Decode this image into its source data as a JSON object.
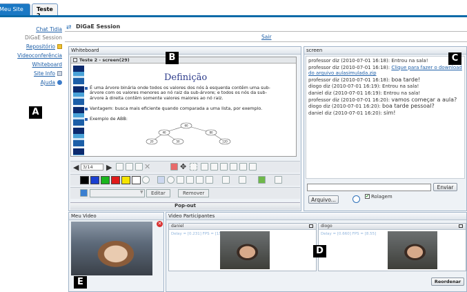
{
  "tabs": [
    {
      "label": "Meu Site"
    },
    {
      "label": "Teste 2"
    }
  ],
  "nav": {
    "items": [
      {
        "label": "Chat Tidia"
      },
      {
        "label": "DiGaE Session"
      },
      {
        "label": "Repositório"
      },
      {
        "label": "Videoconferência"
      },
      {
        "label": "Whiteboard"
      },
      {
        "label": "Site Info"
      },
      {
        "label": "Ajuda"
      }
    ]
  },
  "session": {
    "title": "DiGaE Session",
    "logout": "Sair"
  },
  "whiteboard": {
    "header": "Whiteboard",
    "slide_window_title": "Teste 2 - screen(29)",
    "slide_title": "Definição",
    "bullets": [
      "É uma árvore binária onde todos os valores dos nós à esquerda contêm uma sub-árvore com os valores menores ao nó raiz da sub-árvore; e todos os nós da sub-árvore à direita contêm somente valores maiores ao nó raiz.",
      "Vantagem: busca mais eficiente quando comparada a uma lista, por exemplo.",
      "Exemplo de ABB:"
    ],
    "tree_nodes": [
      "60",
      "40",
      "80",
      "20",
      "50",
      "120"
    ],
    "page_indicator": "3/14",
    "edit_button": "Editar",
    "remove_button": "Remover",
    "popout": "Pop-out",
    "palette": [
      "#000000",
      "#1a3fd1",
      "#19b51e",
      "#e01a1a",
      "#f5e400",
      "#ffffff"
    ]
  },
  "screen": {
    "header": "screen",
    "messages": [
      {
        "prefix": "professor diz (2010-07-01 16:18):",
        "text": "Entrou na sala!",
        "link": false
      },
      {
        "prefix": "professor diz (2010-07-01 16:18):",
        "text": "Clique para fazer o download do arquivo aulasimulada.zip",
        "link": true
      },
      {
        "prefix": "professor diz (2010-07-01 16:18):",
        "text": "boa tarde!",
        "link": false
      },
      {
        "prefix": "diogo diz (2010-07-01 16:19):",
        "text": "Entrou na sala!",
        "link": false
      },
      {
        "prefix": "daniel diz (2010-07-01 16:19):",
        "text": "Entrou na sala!",
        "link": false
      },
      {
        "prefix": "professor diz (2010-07-01 16:20):",
        "text": "vamos começar a aula?",
        "link": false
      },
      {
        "prefix": "diogo diz (2010-07-01 16:20):",
        "text": "boa tarde pessoal?",
        "link": false
      },
      {
        "prefix": "daniel diz (2010-07-01 16:20):",
        "text": "sim!",
        "link": false
      }
    ],
    "input_value": "",
    "send_button": "Enviar",
    "file_button": "Arquivo...",
    "scroll_label": "Rolagem",
    "scroll_checked": true
  },
  "meu_video": {
    "header": "Meu Video"
  },
  "participantes": {
    "header": "Video Participantes",
    "windows": [
      {
        "name": "daniel",
        "stats": "Delay = [0.231] FPS = [15.33]"
      },
      {
        "name": "diogo",
        "stats": "Delay = [0.660] FPS = [8.55]"
      }
    ],
    "reorder_button": "Reordenar"
  },
  "callouts": [
    "A",
    "B",
    "C",
    "D",
    "E"
  ]
}
